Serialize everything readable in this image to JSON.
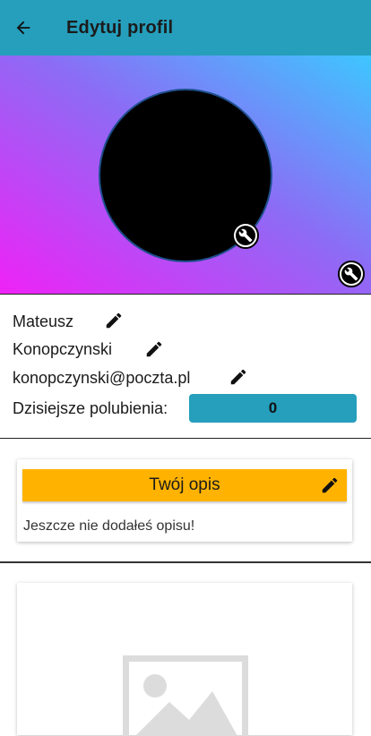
{
  "appbar": {
    "title": "Edytuj profil",
    "back_icon": "arrow-left-icon",
    "color": "#259fbc"
  },
  "header": {
    "gradient_colors": [
      "#ef22f6",
      "#8c6cf5",
      "#3ec6ff"
    ]
  },
  "profile": {
    "first_name": "Mateusz",
    "last_name": "Konopczynski",
    "email": "konopczynski@poczta.pl",
    "likes_label": "Dzisiejsze polubienia:",
    "likes_value": "0"
  },
  "description": {
    "title": "Twój opis",
    "empty_text": "Jeszcze nie dodałeś opisu!",
    "accent": "#ffb300"
  },
  "icons": {
    "edit": "pencil-icon",
    "change": "wrench-icon",
    "placeholder": "image-placeholder-icon"
  }
}
